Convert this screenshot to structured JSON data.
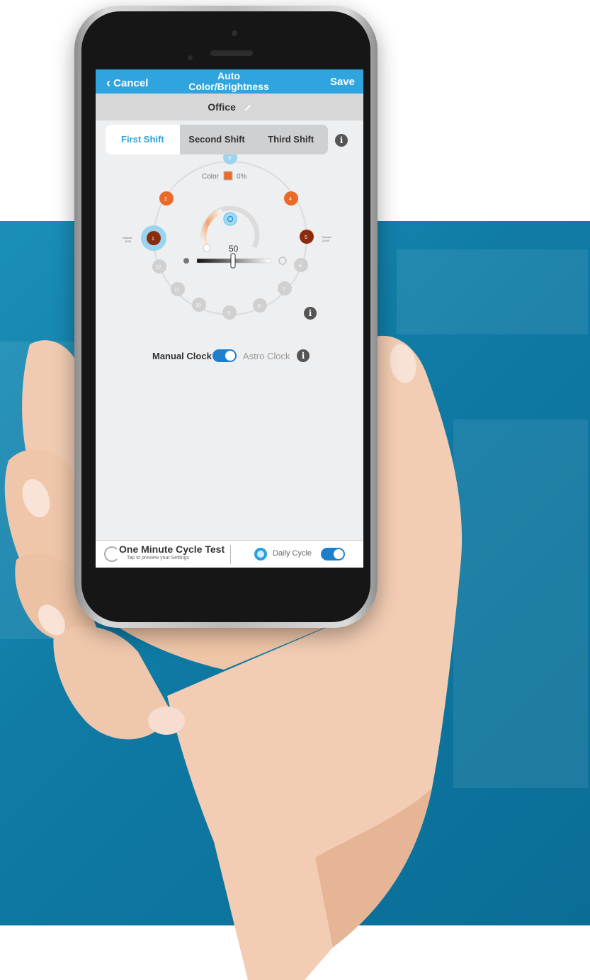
{
  "topbar": {
    "cancel_label": "Cancel",
    "title_line1": "Auto",
    "title_line2": "Color/Brightness",
    "save_label": "Save"
  },
  "location": {
    "name": "Office"
  },
  "tabs": [
    {
      "label": "First Shift",
      "active": true
    },
    {
      "label": "Second Shift",
      "active": false
    },
    {
      "label": "Third Shift",
      "active": false
    }
  ],
  "wheel": {
    "color_label": "Color",
    "color_percent": "0%",
    "brightness_value": "50",
    "sunrise_label": "Sunrise",
    "sunrise_time": "8:00",
    "sunset_label": "Sunset",
    "sunset_time": "20:00",
    "nodes": [
      "1",
      "2",
      "3",
      "4",
      "5",
      "6",
      "7",
      "8",
      "9",
      "10",
      "11",
      "12"
    ]
  },
  "clock": {
    "manual_label": "Manual Clock",
    "astro_label": "Astro Clock"
  },
  "bottom": {
    "cycle_test_title": "One Minute Cycle Test",
    "cycle_test_subtitle": "Tap to preview your Settings",
    "daily_cycle_label": "Daily Cycle"
  },
  "colors": {
    "accent": "#2fa4df",
    "orange": "#ea6a2a",
    "dark_orange": "#8a2b0e",
    "background_panel": "#117fa9"
  }
}
